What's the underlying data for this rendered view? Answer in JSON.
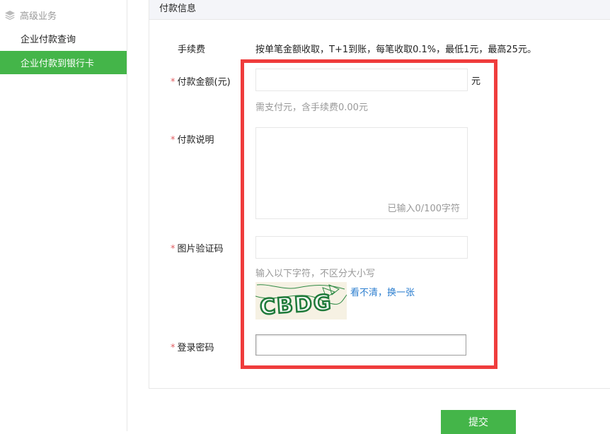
{
  "sidebar": {
    "group_label": "高级业务",
    "items": [
      {
        "label": "企业付款查询"
      },
      {
        "label": "企业付款到银行卡",
        "active": true
      }
    ]
  },
  "panel": {
    "title": "付款信息"
  },
  "form": {
    "fee_label": "手续费",
    "fee_text": "按单笔金额收取，T+1到账，每笔收取0.1%，最低1元，最高25元。",
    "required_mark": "*",
    "amount_label": "付款金额(元)",
    "amount_value": "",
    "amount_unit": "元",
    "amount_hint": "需支付元，含手续费0.00元",
    "desc_label": "付款说明",
    "desc_value": "",
    "desc_counter": "已输入0/100字符",
    "captcha_label": "图片验证码",
    "captcha_value": "",
    "captcha_hint": "输入以下字符，不区分大小写",
    "captcha_image_text": "CBDG",
    "captcha_refresh": "看不清，换一张",
    "password_label": "登录密码",
    "password_value": "",
    "submit_label": "提交"
  },
  "colors": {
    "accent_green": "#44b549",
    "highlight_red": "#ef3c3c",
    "link_blue": "#2b7ecf",
    "required_red": "#e15f63"
  }
}
